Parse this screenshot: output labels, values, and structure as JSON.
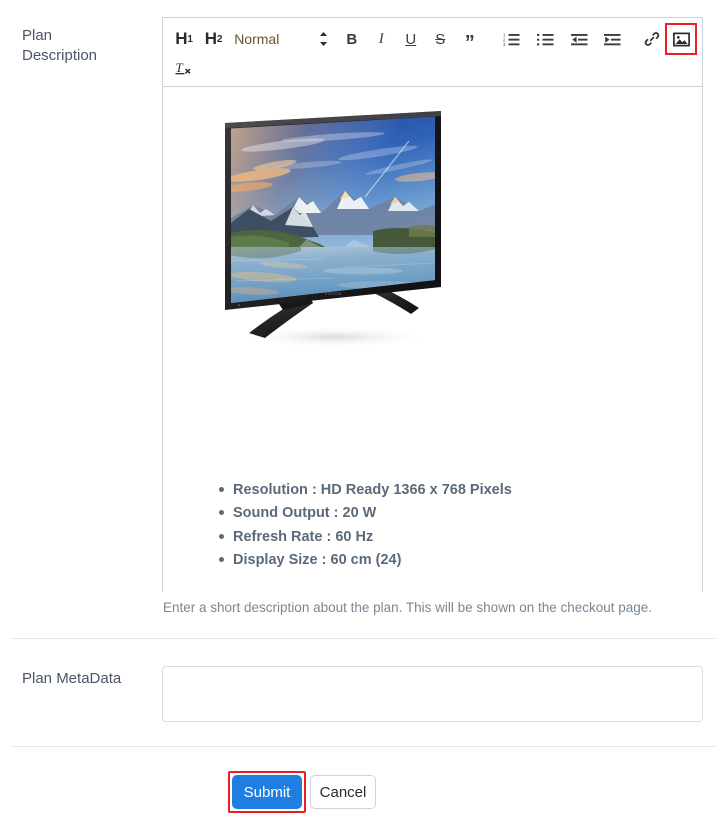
{
  "form": {
    "description_label": "Plan Description",
    "description_label_line1": "Plan",
    "description_label_line2": "Description",
    "metadata_label": "Plan MetaData",
    "help_text": "Enter a short description about the plan. This will be shown on the checkout page.",
    "metadata_value": "",
    "metadata_placeholder": ""
  },
  "toolbar": {
    "h1_label": "H",
    "h1_sub": "1",
    "h2_label": "H",
    "h2_sub": "2",
    "format_picker_value": "Normal",
    "bold_label": "B",
    "italic_label": "I",
    "underline_label": "U",
    "strike_label": "S",
    "blockquote_label": "”",
    "ordered_list_name": "ordered-list",
    "bullet_list_name": "bullet-list",
    "outdent_name": "outdent",
    "indent_name": "indent",
    "link_name": "link",
    "image_name": "image",
    "clear_format_label": "T",
    "clear_format_sub": "x",
    "highlighted_tool": "image"
  },
  "editor_content": {
    "image_alt": "Flat-screen television displaying a mountain lake landscape at sunset",
    "image": {
      "brand_text": "VISION",
      "scene": "mountain-lake-sunset"
    },
    "specs": [
      "Resolution : HD Ready 1366 x 768 Pixels",
      "Sound Output : 20 W",
      "Refresh Rate : 60 Hz",
      "Display Size : 60 cm (24)"
    ]
  },
  "actions": {
    "submit_label": "Submit",
    "cancel_label": "Cancel"
  },
  "colors": {
    "primary": "#1f7fe0",
    "highlight": "#ee1c25",
    "label_text": "#4a5568",
    "spec_text": "#5a6a7a",
    "help_text": "#7a8794",
    "border": "#cfd3d8",
    "divider": "#e6e8ea",
    "picker_text": "#6b5230"
  }
}
